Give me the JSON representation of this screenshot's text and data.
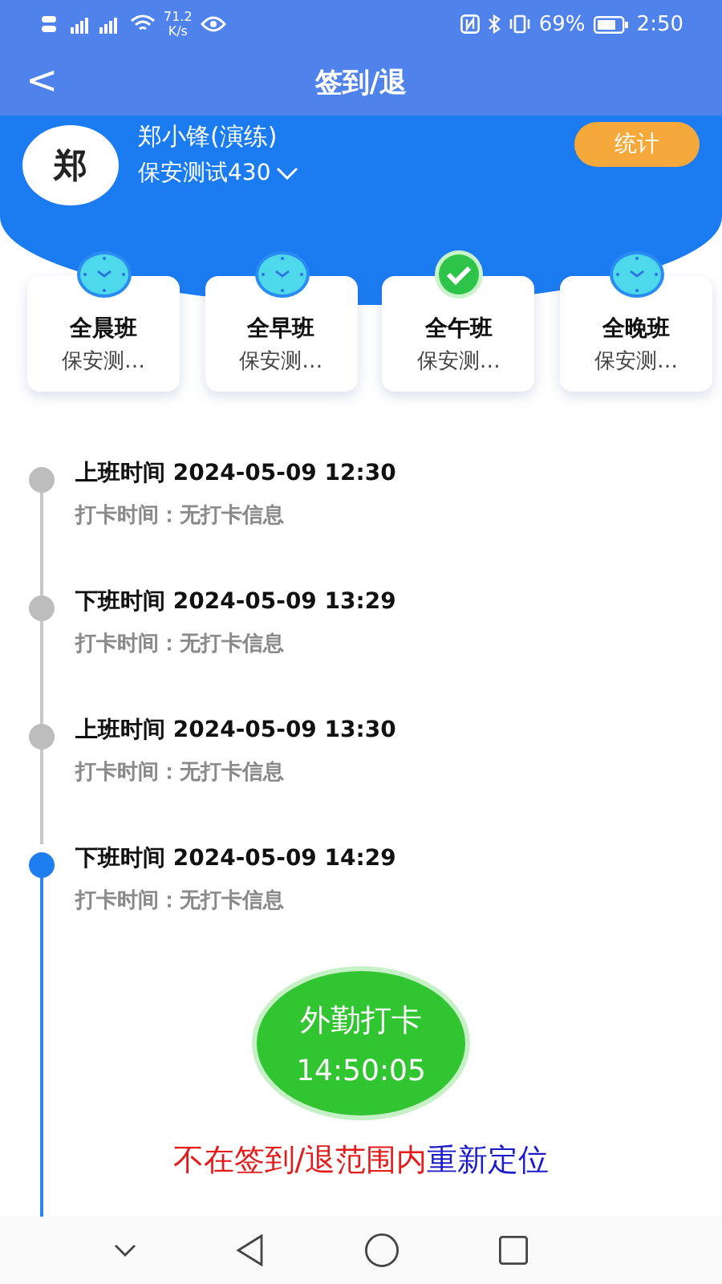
{
  "status_bar": {
    "speed": "71.2",
    "speed_unit": "K/s",
    "battery": "69%",
    "time": "2:50"
  },
  "header": {
    "back": "<",
    "title": "签到/退"
  },
  "profile": {
    "avatar": "郑",
    "name": "郑小锋(演练)",
    "group": "保安测试430",
    "stats_button": "统计"
  },
  "shifts": [
    {
      "name": "全晨班",
      "detail": "保安测…",
      "selected": false
    },
    {
      "name": "全早班",
      "detail": "保安测…",
      "selected": false
    },
    {
      "name": "全午班",
      "detail": "保安测…",
      "selected": true
    },
    {
      "name": "全晚班",
      "detail": "保安测…",
      "selected": false
    }
  ],
  "timeline": [
    {
      "title": "上班时间 2024-05-09 12:30",
      "record": "打卡时间：无打卡信息",
      "active": false
    },
    {
      "title": "下班时间 2024-05-09 13:29",
      "record": "打卡时间：无打卡信息",
      "active": false
    },
    {
      "title": "上班时间 2024-05-09 13:30",
      "record": "打卡时间：无打卡信息",
      "active": false
    },
    {
      "title": "下班时间 2024-05-09 14:29",
      "record": "打卡时间：无打卡信息",
      "active": true
    }
  ],
  "punch_button": {
    "label": "外勤打卡",
    "time": "14:50:05"
  },
  "notice": {
    "message": "不在签到/退范围内",
    "link": "重新定位"
  }
}
